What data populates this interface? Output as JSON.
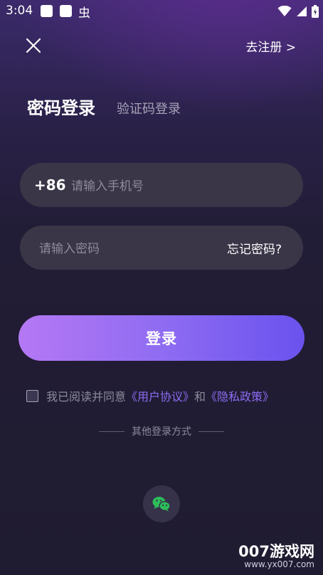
{
  "status_bar": {
    "time": "3:04",
    "bug_glyph": "虫",
    "icons": [
      "wifi-icon",
      "signal-icon",
      "battery-icon"
    ]
  },
  "header": {
    "close_icon": "close-icon",
    "register_link": "去注册 >"
  },
  "tabs": [
    {
      "label": "密码登录",
      "active": true
    },
    {
      "label": "验证码登录",
      "active": false
    }
  ],
  "phone": {
    "country_code": "+86",
    "placeholder": "请输入手机号"
  },
  "password": {
    "placeholder": "请输入密码",
    "forgot_label": "忘记密码?"
  },
  "login_button": {
    "label": "登录"
  },
  "agreement": {
    "checked": false,
    "prefix": "我已阅读并同意",
    "user_agreement": "《用户协议》",
    "conjunction": "和",
    "privacy_policy": "《隐私政策》"
  },
  "other_login": {
    "label": "其他登录方式",
    "options": [
      "wechat-icon"
    ]
  },
  "watermark": {
    "title": "007游戏网",
    "url": "www.yx007.com"
  },
  "colors": {
    "accent": "#8c6cf4",
    "gradient_start": "#b578f4",
    "gradient_end": "#6a52ee",
    "wechat": "#2dbd5a"
  }
}
